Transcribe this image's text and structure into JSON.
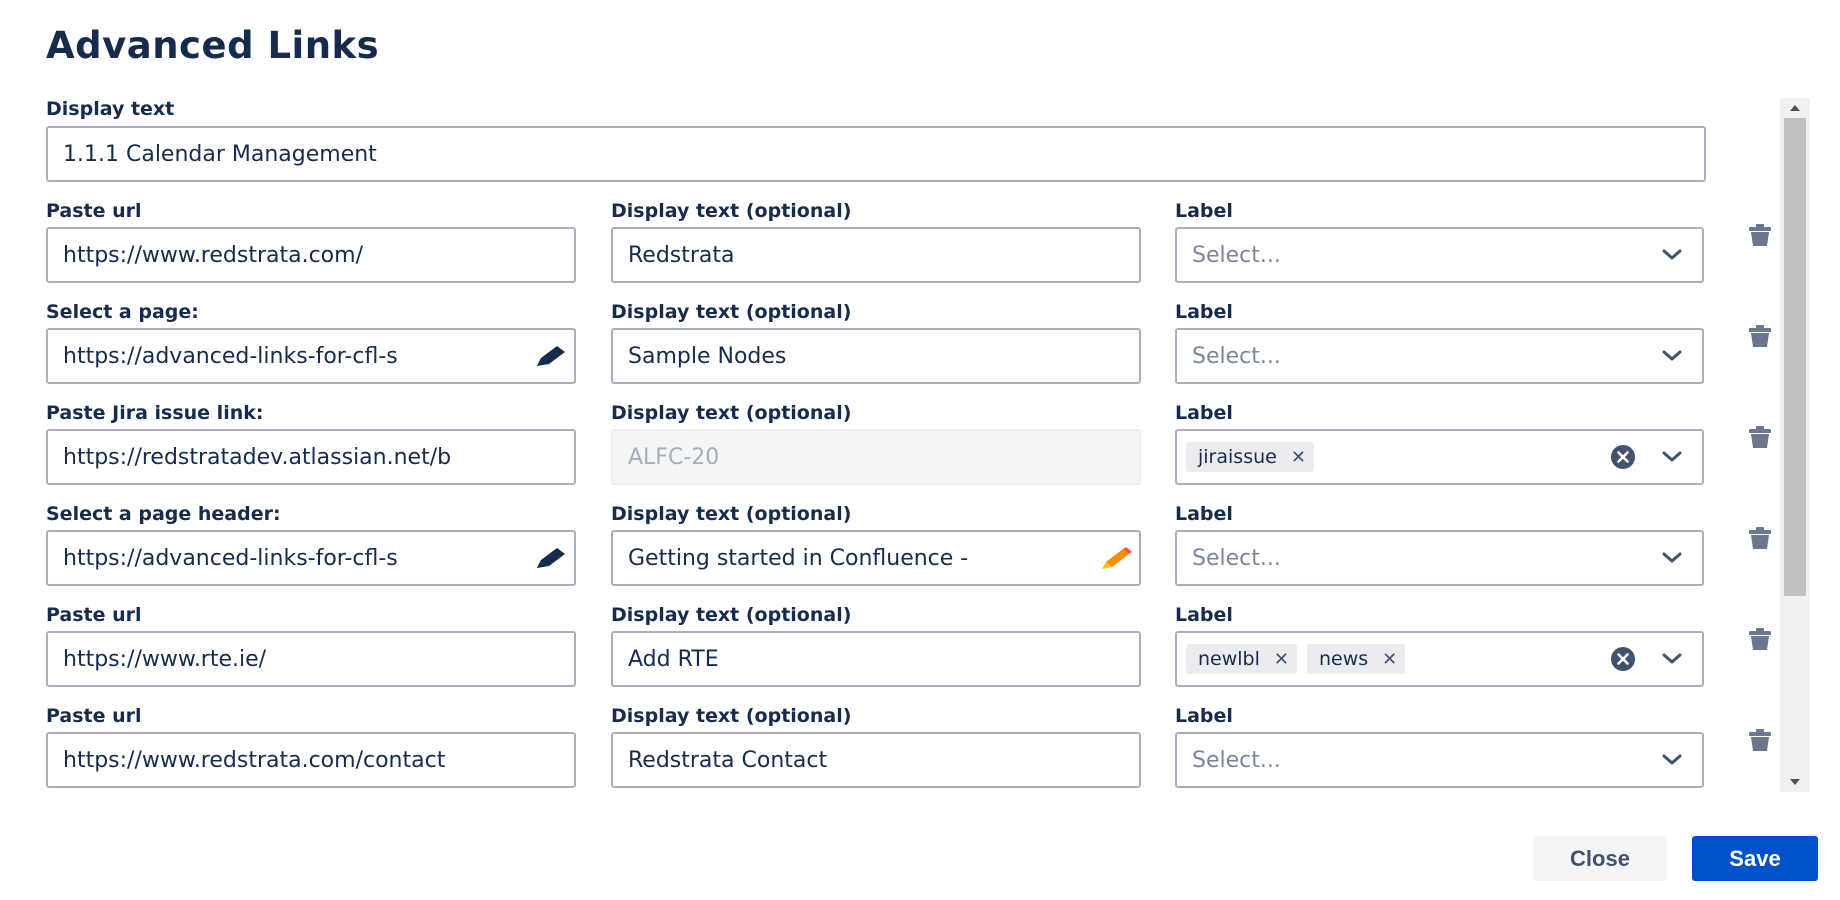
{
  "dialog": {
    "title": "Advanced Links"
  },
  "display_text": {
    "label": "Display text",
    "value": "1.1.1 Calendar Management"
  },
  "rows": [
    {
      "url_label": "Paste url",
      "url_value": "https://www.redstrata.com/",
      "url_icon": "",
      "text_label": "Display text (optional)",
      "text_value": "Redstrata",
      "text_disabled": false,
      "text_icon": "",
      "label_label": "Label",
      "label_placeholder": "Select...",
      "tags": []
    },
    {
      "url_label": "Select a page:",
      "url_value": "https://advanced-links-for-cfl-s",
      "url_icon": "pencil-icon",
      "text_label": "Display text (optional)",
      "text_value": "Sample Nodes",
      "text_disabled": false,
      "text_icon": "",
      "label_label": "Label",
      "label_placeholder": "Select...",
      "tags": []
    },
    {
      "url_label": "Paste Jira issue link:",
      "url_value": "https://redstratadev.atlassian.net/b",
      "url_icon": "",
      "text_label": "Display text (optional)",
      "text_value": "ALFC-20",
      "text_disabled": true,
      "text_icon": "",
      "label_label": "Label",
      "label_placeholder": "Select...",
      "tags": [
        "jiraissue"
      ]
    },
    {
      "url_label": "Select a page header:",
      "url_value": "https://advanced-links-for-cfl-s",
      "url_icon": "pencil-icon",
      "text_label": "Display text (optional)",
      "text_value": "Getting started in Confluence -",
      "text_disabled": false,
      "text_icon": "pencil-orange-icon",
      "label_label": "Label",
      "label_placeholder": "Select...",
      "tags": []
    },
    {
      "url_label": "Paste url",
      "url_value": "https://www.rte.ie/",
      "url_icon": "",
      "text_label": "Display text (optional)",
      "text_value": "Add RTE",
      "text_disabled": false,
      "text_icon": "",
      "label_label": "Label",
      "label_placeholder": "Select...",
      "tags": [
        "newlbl",
        "news"
      ]
    },
    {
      "url_label": "Paste url",
      "url_value": "https://www.redstrata.com/contact",
      "url_icon": "",
      "text_label": "Display text (optional)",
      "text_value": "Redstrata Contact",
      "text_disabled": false,
      "text_icon": "",
      "label_label": "Label",
      "label_placeholder": "Select...",
      "tags": []
    }
  ],
  "footer": {
    "close_label": "Close",
    "save_label": "Save"
  },
  "colors": {
    "primary": "#0052cc",
    "border": "#a9b0bc",
    "text": "#172b4d",
    "pencil_accent": "#ff8b00"
  }
}
